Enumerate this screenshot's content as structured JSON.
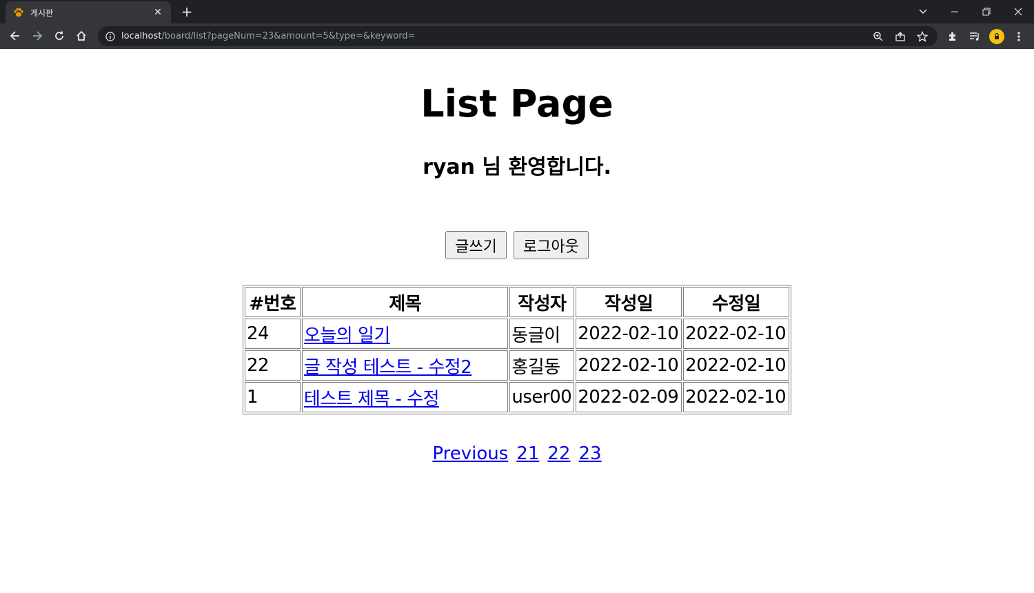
{
  "browser": {
    "tab_title": "게시판",
    "tab_close": "✕",
    "new_tab": "+",
    "url_host": "localhost",
    "url_rest": "/board/list?pageNum=23&amount=5&type=&keyword=",
    "icons": [
      "back-icon",
      "forward-icon",
      "reload-icon",
      "home-icon",
      "info-icon",
      "zoom-icon",
      "share-icon",
      "star-icon",
      "extensions-icon",
      "media-icon",
      "profile-icon",
      "menu-icon"
    ]
  },
  "page": {
    "title": "List Page",
    "welcome": "ryan 님 환영합니다.",
    "buttons": {
      "write": "글쓰기",
      "logout": "로그아웃"
    },
    "table": {
      "headers": [
        "#번호",
        "제목",
        "작성자",
        "작성일",
        "수정일"
      ],
      "rows": [
        {
          "no": "24",
          "title": "오늘의 일기",
          "writer": "동글이",
          "regdate": "2022-02-10",
          "updatedate": "2022-02-10"
        },
        {
          "no": "22",
          "title": "글 작성 테스트 - 수정2",
          "writer": "홍길동",
          "regdate": "2022-02-10",
          "updatedate": "2022-02-10"
        },
        {
          "no": "1",
          "title": "테스트 제목 - 수정",
          "writer": "user00",
          "regdate": "2022-02-09",
          "updatedate": "2022-02-10"
        }
      ]
    },
    "pagination": {
      "previous": "Previous",
      "pages": [
        "21",
        "22",
        "23"
      ]
    }
  }
}
